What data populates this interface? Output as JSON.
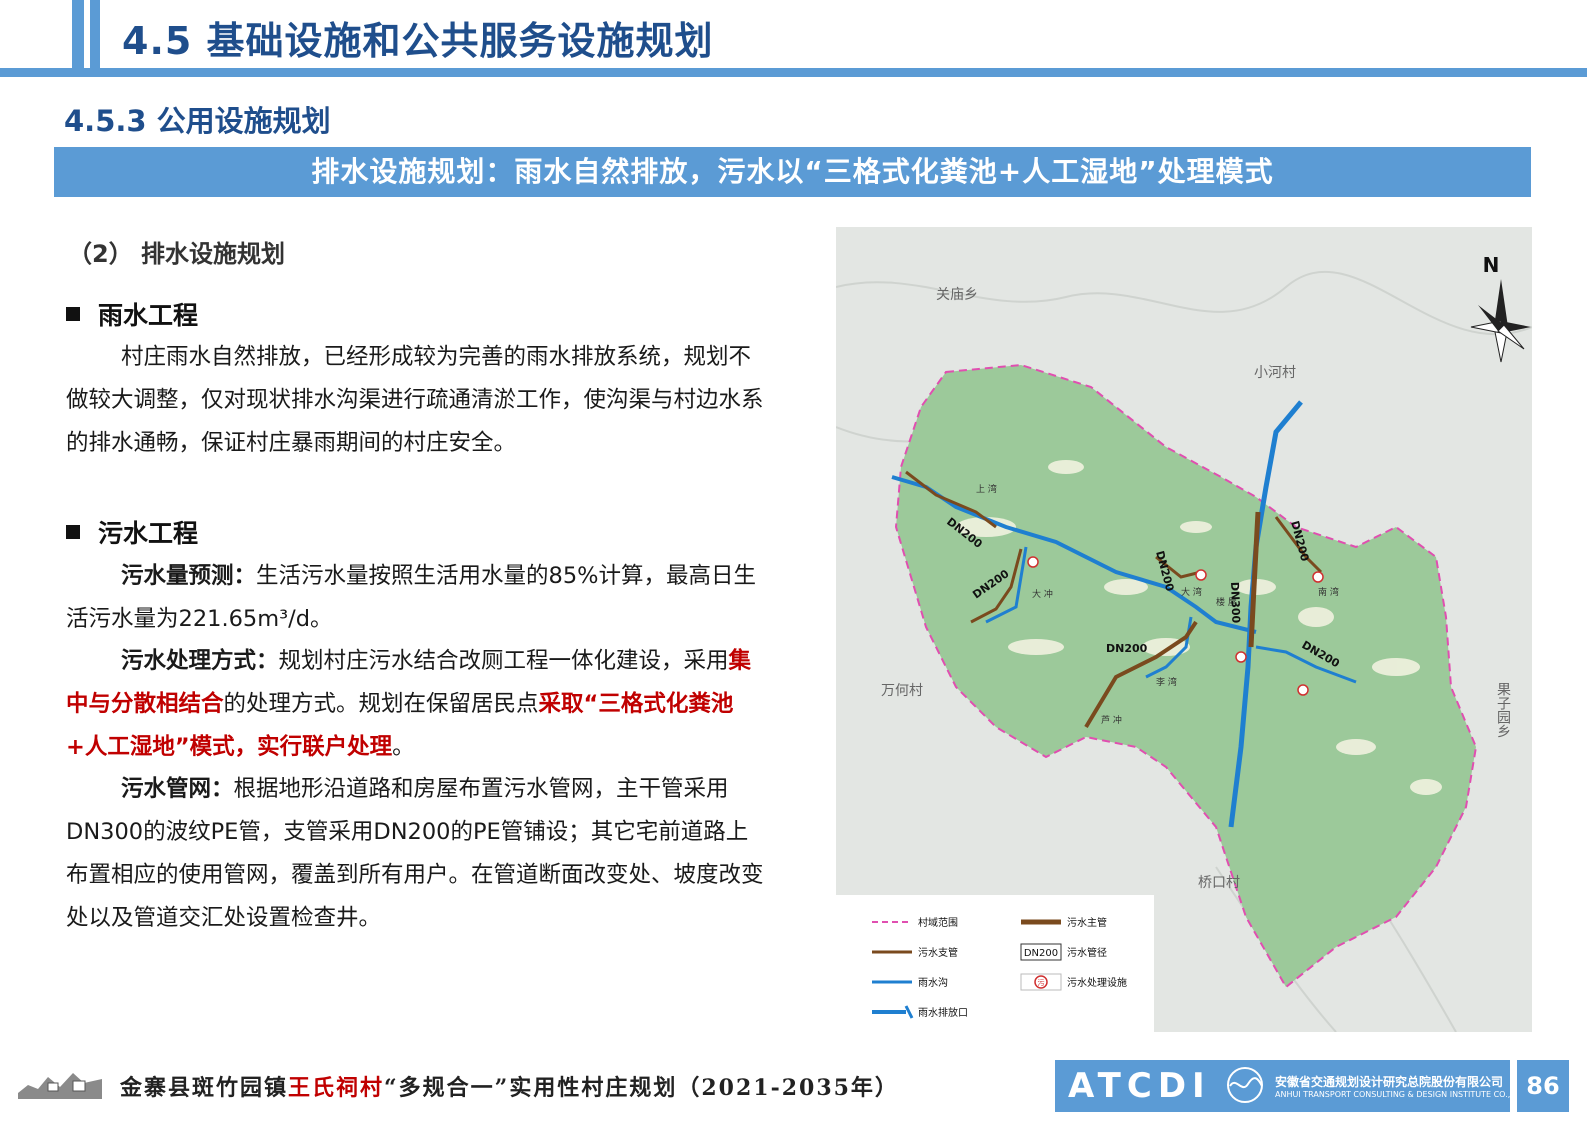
{
  "header": {
    "title": "4.5 基础设施和公共服务设施规划",
    "subtitle": "4.5.3  公用设施规划",
    "banner": "排水设施规划：雨水自然排放，污水以“三格式化粪池+人工湿地”处理模式"
  },
  "content": {
    "section": "（2） 排水设施规划",
    "rain": {
      "heading": "雨水工程",
      "body": "村庄雨水自然排放，已经形成较为完善的雨水排放系统，规划不做较大调整，仅对现状排水沟渠进行疏通清淤工作，使沟渠与村边水系的排水通畅，保证村庄暴雨期间的村庄安全。"
    },
    "sewage": {
      "heading": "污水工程",
      "p1_label": "污水量预测：",
      "p1_text": "生活污水量按照生活用水量的85%计算，最高日生活污水量为221.65m³/d。",
      "p2_label": "污水处理方式：",
      "p2_text_a": "规划村庄污水结合改厕工程一体化建设，采用",
      "p2_red_a": "集中与分散相结合",
      "p2_text_b": "的处理方式。规划在保留居民点",
      "p2_red_b": "采取“三格式化粪池+人工湿地”模式，实行联户处理",
      "p2_text_c": "。",
      "p3_label": "污水管网：",
      "p3_text": "根据地形沿道路和房屋布置污水管网，主干管采用DN300的波纹PE管，支管采用DN200的PE管铺设；其它宅前道路上布置相应的使用管网，覆盖到所有用户。在管道断面改变处、坡度改变处以及管道交汇处设置检查井。"
    }
  },
  "map": {
    "north": "N",
    "places": {
      "guanmiao": "关庙乡",
      "xiaohe": "小河村",
      "wanhe": "万何村",
      "guoziyuan": "果子园乡",
      "qiaokou": "桥口村",
      "shangwan": "上 湾",
      "dachong": "大 冲",
      "dawan": "大 湾",
      "louwu": "楼 屋",
      "nanwan": "南 湾",
      "liwan": "李 湾",
      "luchong": "芦 冲"
    },
    "pipe_labels": {
      "dn200_a": "DN200",
      "dn200_b": "DN200",
      "dn200_c": "DN200",
      "dn200_d": "DN200",
      "dn200_e": "DN200",
      "dn200_f": "DN200",
      "dn300": "DN300"
    },
    "legend": {
      "boundary": "村域范围",
      "main_pipe": "污水主管",
      "branch_pipe": "污水支管",
      "pipe_dia_tag": "DN200",
      "pipe_dia": "污水管径",
      "rain_ditch": "雨水沟",
      "facility_tag": "污",
      "facility": "污水处理设施",
      "outlet": "雨水排放口"
    },
    "colors": {
      "village": "#9cc99a",
      "terrain": "#e3e6e3",
      "rain": "#1f7fd0",
      "sewage": "#7a4a1e",
      "boundary": "#e04fb0"
    }
  },
  "footer": {
    "title_a": "金寨县斑竹园镇",
    "title_hl": "王氏祠村",
    "title_b": "“多规合一”实用性村庄规划（2021-2035年）",
    "logo": "ATCDI",
    "company_cn": "安徽省交通规划设计研究总院股份有限公司",
    "company_en": "ANHUI TRANSPORT CONSULTING & DESIGN INSTITUTE CO.,LTD.",
    "page": "86"
  }
}
